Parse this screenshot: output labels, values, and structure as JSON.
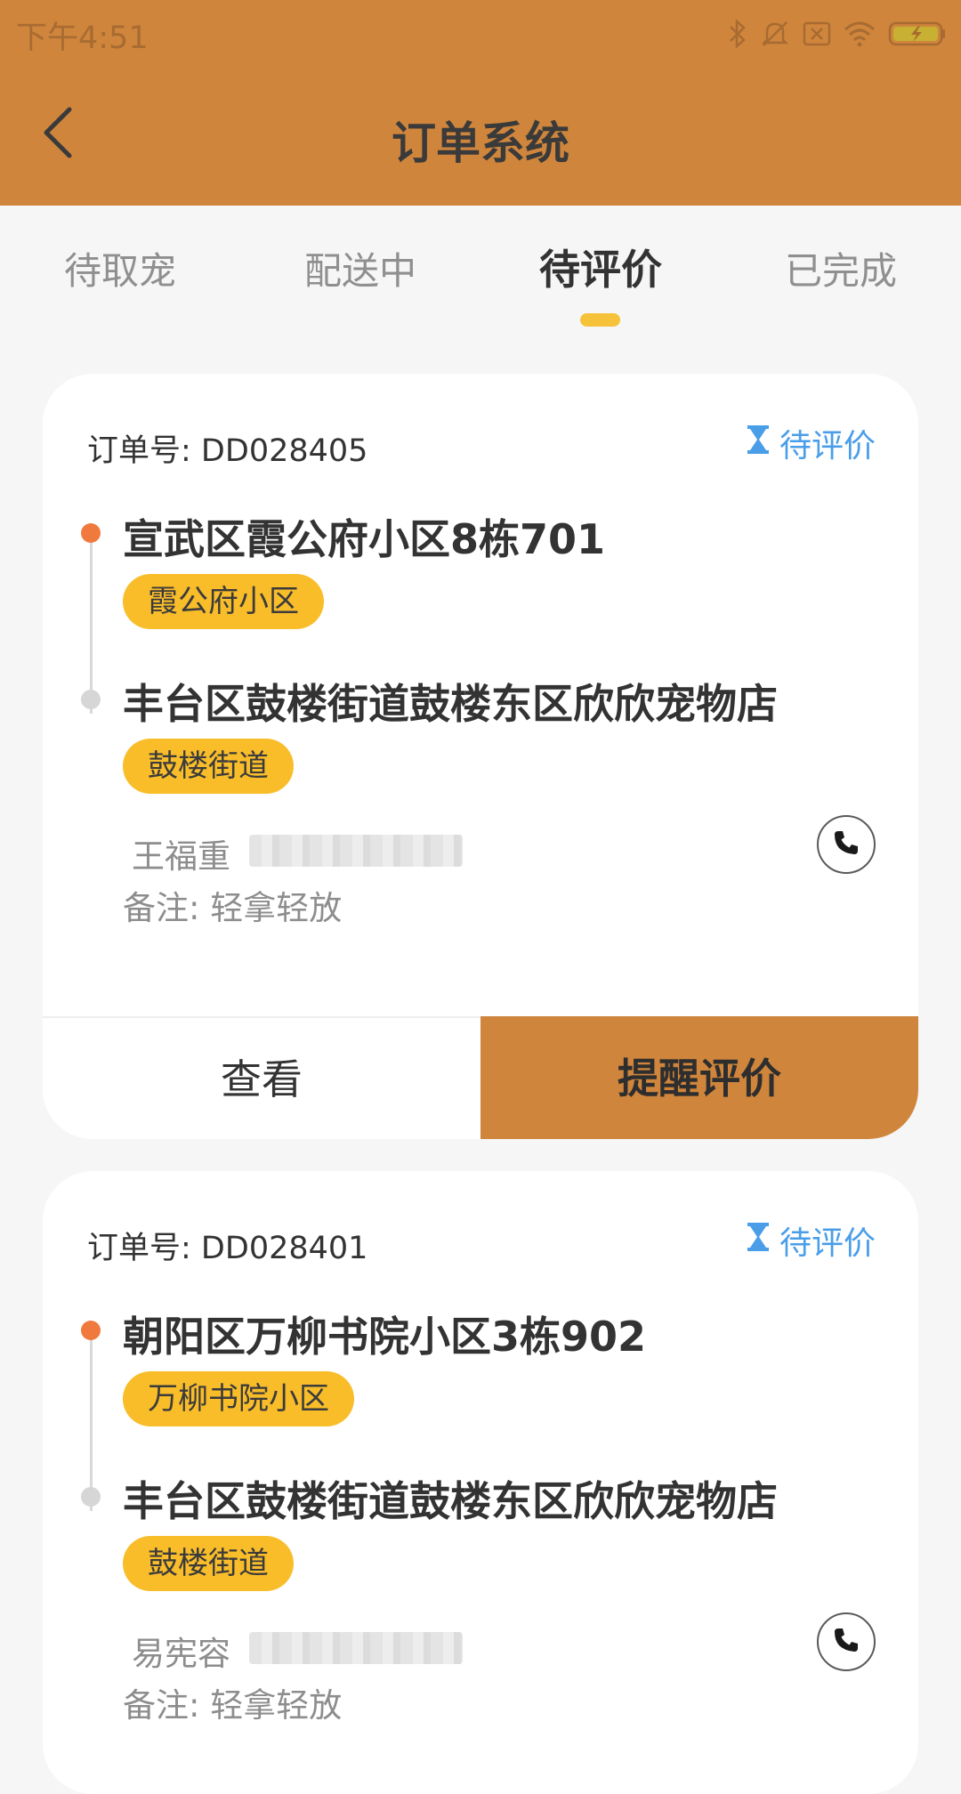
{
  "status_bar": {
    "time": "下午4:51",
    "icons": [
      "bluetooth-icon",
      "mute-icon",
      "sim-icon",
      "wifi-icon",
      "battery-charging-icon"
    ]
  },
  "header": {
    "title": "订单系统",
    "back_icon": "chevron-left-icon"
  },
  "tabs": [
    {
      "label": "待取宠",
      "active": false
    },
    {
      "label": "配送中",
      "active": false
    },
    {
      "label": "待评价",
      "active": true
    },
    {
      "label": "已完成",
      "active": false
    }
  ],
  "orders": [
    {
      "order_no": "订单号: DD028405",
      "status": "待评价",
      "from_address": "宣武区霞公府小区8栋701",
      "from_tag": "霞公府小区",
      "to_address": "丰台区鼓楼街道鼓楼东区欣欣宠物店",
      "to_tag": "鼓楼街道",
      "contact_name": "王福重",
      "remark": "备注: 轻拿轻放",
      "view_label": "查看",
      "remind_label": "提醒评价"
    },
    {
      "order_no": "订单号: DD028401",
      "status": "待评价",
      "from_address": "朝阳区万柳书院小区3栋902",
      "from_tag": "万柳书院小区",
      "to_address": "丰台区鼓楼街道鼓楼东区欣欣宠物店",
      "to_tag": "鼓楼街道",
      "contact_name": "易宪容",
      "remark": "备注: 轻拿轻放"
    }
  ],
  "colors": {
    "brand": "#cf853c",
    "tag": "#f9bd2a",
    "status": "#4a9ee8",
    "indicator": "#f6c23a",
    "start_dot": "#f07a3e"
  }
}
